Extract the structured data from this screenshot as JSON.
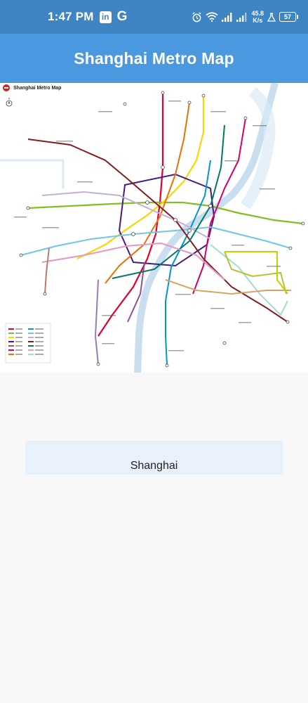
{
  "status_bar": {
    "time": "1:47 PM",
    "linkedin": "in",
    "google": "G",
    "net_speed_value": "45.8",
    "net_speed_unit": "K/s",
    "battery": "57"
  },
  "app_bar": {
    "title": "Shanghai Metro Map"
  },
  "map": {
    "title": "Shanghai Metro Map"
  },
  "location": {
    "label": "Shanghai"
  }
}
